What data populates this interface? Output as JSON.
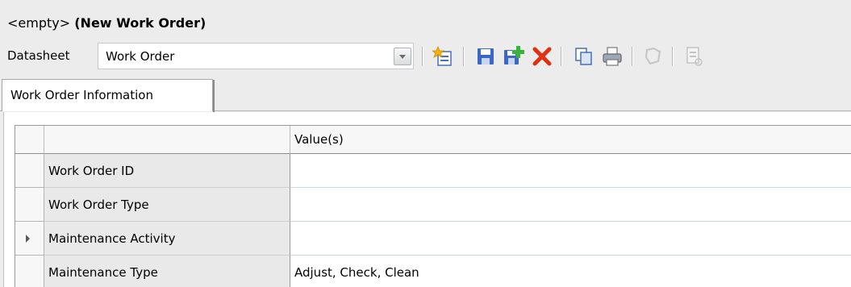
{
  "header": {
    "title_prefix": "<empty>",
    "title_main": "(New Work Order)"
  },
  "toolbar": {
    "datasheet_label": "Datasheet",
    "datasheet_value": "Work Order",
    "buttons": [
      {
        "name": "new-record-icon",
        "enabled": true
      },
      {
        "name": "save-icon",
        "enabled": true
      },
      {
        "name": "save-and-add-icon",
        "enabled": true
      },
      {
        "name": "delete-icon",
        "enabled": true
      },
      {
        "name": "copy-icon",
        "enabled": true
      },
      {
        "name": "print-icon",
        "enabled": true
      },
      {
        "name": "associate-icon",
        "enabled": false
      },
      {
        "name": "report-icon",
        "enabled": false
      }
    ],
    "colors": {
      "save": "#3b67c7",
      "add": "#39b339",
      "delete": "#e03010",
      "disabled": "#c4c4c4"
    }
  },
  "tabs": [
    {
      "label": "Work Order Information",
      "active": true
    }
  ],
  "grid": {
    "columns": [
      "",
      "Value(s)"
    ],
    "rows": [
      {
        "field": "Work Order ID",
        "value": "",
        "current": false
      },
      {
        "field": "Work Order Type",
        "value": "",
        "current": false
      },
      {
        "field": "Maintenance Activity",
        "value": "",
        "current": true
      },
      {
        "field": "Maintenance Type",
        "value": "Adjust, Check, Clean",
        "current": false
      }
    ]
  }
}
